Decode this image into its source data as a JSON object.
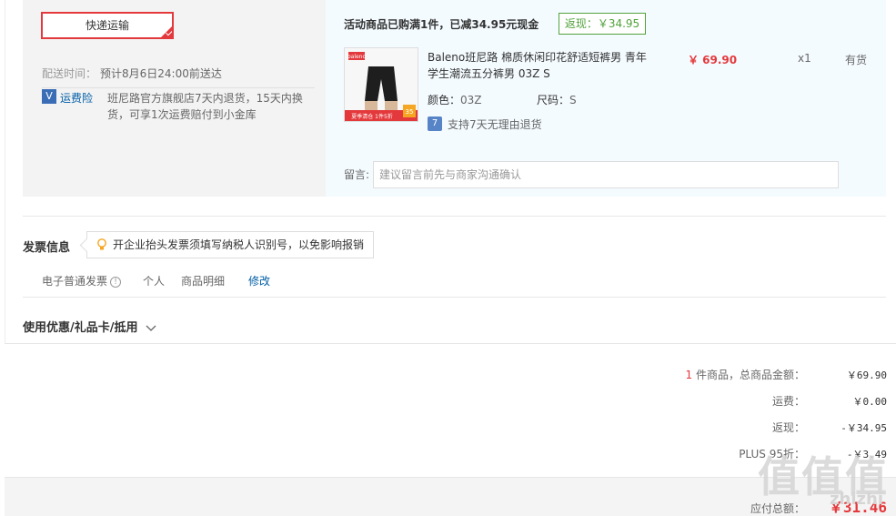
{
  "shipping": {
    "method_label": "快递运输",
    "delivery_time_label": "配送时间：",
    "delivery_time_value": "预计8月6日24:00前送达",
    "insurance_icon": "V",
    "insurance_label": "运费险",
    "insurance_desc_line1": "班尼路官方旗舰店7天内退货，15天内换",
    "insurance_desc_line2": "货，可享1次运费赔付到小金库"
  },
  "order": {
    "promo_text": "活动商品已购满1件，已减34.95元现金",
    "rebate_tag": "返现：￥34.95",
    "product": {
      "name_line1": "Baleno班尼路 棉质休闲印花舒适短裤男 青年",
      "name_line2": "学生潮流五分裤男 03Z S",
      "price": "￥ 69.90",
      "qty": "x1",
      "stock": "有货",
      "color_label": "颜色：",
      "color_value": "03Z",
      "size_label": "尺码：",
      "size_value": "S",
      "image_brand": "baleno",
      "image_banner": "夏季清仓 1件5折",
      "image_badge": "35",
      "return_icon": "7",
      "return_policy": "支持7天无理由退货"
    },
    "message_label": "留言:",
    "message_placeholder": "建议留言前先与商家沟通确认"
  },
  "invoice": {
    "title": "发票信息",
    "tooltip": "开企业抬头发票须填写纳税人识别号，以免影响报销",
    "type": "电子普通发票",
    "info_icon": "!",
    "holder": "个人",
    "content": "商品明细",
    "edit_link": "修改"
  },
  "coupon": {
    "title": "使用优惠/礼品卡/抵用"
  },
  "summary": {
    "count": "1",
    "count_label": "件商品，总商品金额：",
    "total": "￥69.90",
    "shipping_label": "运费：",
    "shipping": "￥0.00",
    "rebate_label": "返现：",
    "rebate": "-￥34.95",
    "plus_label": "PLUS 95折：",
    "plus": "-￥3.49",
    "payable_label": "应付总额：",
    "payable": "￥31.46"
  },
  "watermark": {
    "logo": "值值值",
    "url": "zhizhi"
  },
  "colors": {
    "accent_red": "#e4393c",
    "green": "#51a23b",
    "link_blue": "#005ea7"
  }
}
